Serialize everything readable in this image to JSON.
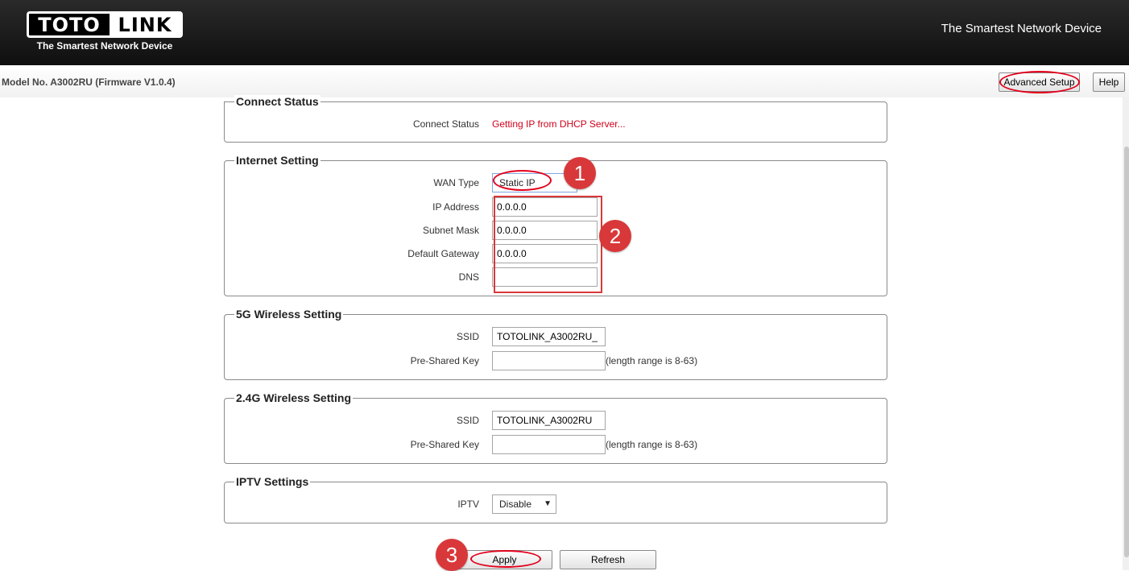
{
  "header": {
    "logo_left": "TOTO",
    "logo_right": "LINK",
    "logo_tagline": "The Smartest Network Device",
    "slogan": "The Smartest Network Device"
  },
  "subbar": {
    "model": "Model No. A3002RU (Firmware V1.0.4)",
    "advanced_setup": "Advanced Setup",
    "help": "Help"
  },
  "connect_status": {
    "legend": "Connect Status",
    "label": "Connect Status",
    "value": "Getting IP from DHCP Server..."
  },
  "internet_setting": {
    "legend": "Internet Setting",
    "wan_type_label": "WAN Type",
    "wan_type_value": "Static IP",
    "ip_label": "IP Address",
    "ip_value": "0.0.0.0",
    "mask_label": "Subnet Mask",
    "mask_value": "0.0.0.0",
    "gateway_label": "Default Gateway",
    "gateway_value": "0.0.0.0",
    "dns_label": "DNS",
    "dns_value": ""
  },
  "wireless_5g": {
    "legend": "5G Wireless Setting",
    "ssid_label": "SSID",
    "ssid_value": "TOTOLINK_A3002RU_",
    "psk_label": "Pre-Shared Key",
    "psk_value": "",
    "psk_hint": "(length range is 8-63)"
  },
  "wireless_24g": {
    "legend": "2.4G Wireless Setting",
    "ssid_label": "SSID",
    "ssid_value": "TOTOLINK_A3002RU",
    "psk_label": "Pre-Shared Key",
    "psk_value": "",
    "psk_hint": "(length range is 8-63)"
  },
  "iptv": {
    "legend": "IPTV Settings",
    "label": "IPTV",
    "value": "Disable"
  },
  "actions": {
    "apply": "Apply",
    "refresh": "Refresh"
  },
  "annotations": {
    "step1": "1",
    "step2": "2",
    "step3": "3"
  },
  "colors": {
    "status_red": "#d0021b",
    "annotation_red": "#d9383a"
  }
}
